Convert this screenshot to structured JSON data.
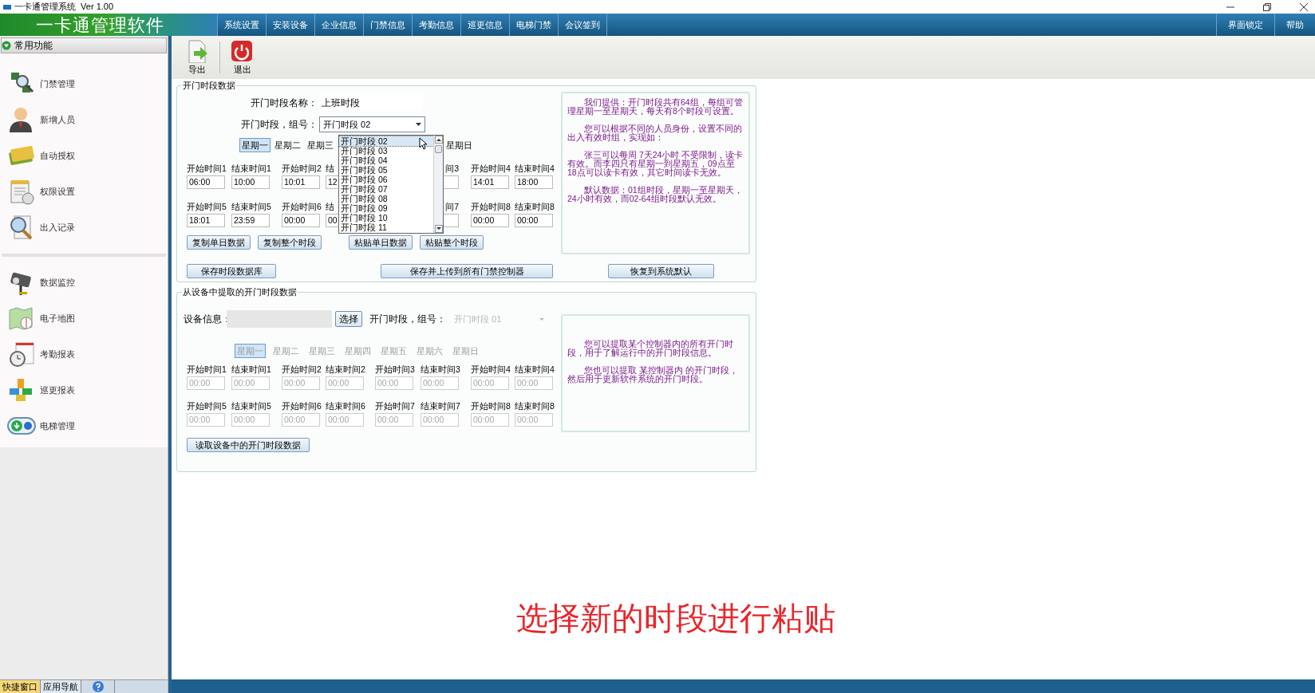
{
  "window": {
    "title": "一卡通管理系统  Ver 1.00"
  },
  "menu_bar": {
    "app_name": "一卡通管理软件",
    "items": [
      "系统设置",
      "安装设备",
      "企业信息",
      "门禁信息",
      "考勤信息",
      "巡更信息",
      "电梯门禁",
      "会议签到"
    ],
    "right_items": [
      "界面锁定",
      "帮助"
    ]
  },
  "sidebar": {
    "header": "常用功能",
    "groups": [
      [
        "门禁管理",
        "新增人员",
        "自动授权",
        "权限设置",
        "出入记录"
      ],
      [
        "数据监控",
        "电子地图",
        "考勤报表",
        "巡更报表",
        "电梯管理"
      ]
    ],
    "bottom_tabs": [
      {
        "label": "快捷窗口",
        "selected": true
      },
      {
        "label": "应用导航",
        "selected": false
      }
    ]
  },
  "toolbar": [
    "导出",
    "退出"
  ],
  "period_section": {
    "title": "开门时段数据",
    "name_label": "开门时段名称：",
    "name_value": "上班时段",
    "group_label": "开门时段，组号：",
    "group_value": "开门时段 02",
    "weekdays": [
      {
        "label": "星期一",
        "selected": true
      },
      {
        "label": "星期二",
        "selected": false
      },
      {
        "label": "星期三",
        "selected": false
      },
      {
        "label": "星期日",
        "selected": false
      }
    ],
    "rows": [
      [
        {
          "kind": "field",
          "label": "开始时间1",
          "value": "06:00"
        },
        {
          "kind": "field",
          "label": "结束时间1",
          "value": "10:00"
        },
        {
          "kind": "field",
          "label": "开始时间2",
          "value": "10:01"
        },
        {
          "kind": "field",
          "label": "结",
          "value": "12"
        },
        {
          "kind": "covered"
        },
        {
          "kind": "tail",
          "label": "间3"
        },
        {
          "kind": "field",
          "label": "开始时间4",
          "value": "14:01"
        },
        {
          "kind": "field",
          "label": "结束时间4",
          "value": "18:00"
        }
      ],
      [
        {
          "kind": "field",
          "label": "开始时间5",
          "value": "18:01"
        },
        {
          "kind": "field",
          "label": "结束时间5",
          "value": "23:59"
        },
        {
          "kind": "field",
          "label": "开始时间6",
          "value": "00:00"
        },
        {
          "kind": "field",
          "label": "结",
          "value": "00"
        },
        {
          "kind": "covered"
        },
        {
          "kind": "tail",
          "label": "间7"
        },
        {
          "kind": "field",
          "label": "开始时间8",
          "value": "00:00"
        },
        {
          "kind": "field",
          "label": "结束时间8",
          "value": "00:00"
        }
      ]
    ],
    "copy_buttons": [
      "复制单日数据",
      "复制整个时段"
    ],
    "paste_buttons": [
      "粘贴单日数据",
      "粘贴整个时段"
    ],
    "save_buttons": [
      "保存时段数据库",
      "保存并上传到所有门禁控制器",
      "恢复到系统默认"
    ],
    "info": [
      "我们提供：开门时段共有64组，每组可管理星期一至星期天，每天有8个时段可设置。",
      "您可以根据不同的人员身份，设置不同的出入有效时组，实现如：",
      "张三可以每周 7天24小时 不受限制，读卡有效。而李四只有星期一到星期五，09点至18点可以读卡有效，其它时间读卡无效。",
      "默认数据：01组时段，星期一至星期天，24小时有效，而02-64组时段默认无效。"
    ],
    "dropdown": [
      {
        "label": "开门时段 02",
        "selected": true
      },
      {
        "label": "开门时段 03",
        "selected": false
      },
      {
        "label": "开门时段 04",
        "selected": false
      },
      {
        "label": "开门时段 05",
        "selected": false
      },
      {
        "label": "开门时段 06",
        "selected": false
      },
      {
        "label": "开门时段 07",
        "selected": false
      },
      {
        "label": "开门时段 08",
        "selected": false
      },
      {
        "label": "开门时段 09",
        "selected": false
      },
      {
        "label": "开门时段 10",
        "selected": false
      },
      {
        "label": "开门时段 11",
        "selected": false
      }
    ]
  },
  "device_section": {
    "title": "从设备中提取的开门时段数据",
    "device_label": "设备信息：",
    "select_button": "选择",
    "group_label": "开门时段，组号：",
    "group_value": "开门时段 01",
    "weekdays": [
      {
        "label": "星期一",
        "selected": true
      },
      {
        "label": "星期二",
        "selected": false
      },
      {
        "label": "星期三",
        "selected": false
      },
      {
        "label": "星期四",
        "selected": false
      },
      {
        "label": "星期五",
        "selected": false
      },
      {
        "label": "星期六",
        "selected": false
      },
      {
        "label": "星期日",
        "selected": false
      }
    ],
    "rows": [
      [
        {
          "kind": "field",
          "label": "开始时间1",
          "value": "00:00"
        },
        {
          "kind": "field",
          "label": "结束时间1",
          "value": "00:00"
        },
        {
          "kind": "field",
          "label": "开始时间2",
          "value": "00:00"
        },
        {
          "kind": "field",
          "label": "结束时间2",
          "value": "00:00"
        },
        {
          "kind": "field",
          "label": "开始时间3",
          "value": "00:00"
        },
        {
          "kind": "field",
          "label": "结束时间3",
          "value": "00:00"
        },
        {
          "kind": "field",
          "label": "开始时间4",
          "value": "00:00"
        },
        {
          "kind": "field",
          "label": "结束时间4",
          "value": "00:00"
        }
      ],
      [
        {
          "kind": "field",
          "label": "开始时间5",
          "value": "00:00"
        },
        {
          "kind": "field",
          "label": "结束时间5",
          "value": "00:00"
        },
        {
          "kind": "field",
          "label": "开始时间6",
          "value": "00:00"
        },
        {
          "kind": "field",
          "label": "结束时间6",
          "value": "00:00"
        },
        {
          "kind": "field",
          "label": "开始时间7",
          "value": "00:00"
        },
        {
          "kind": "field",
          "label": "结束时间7",
          "value": "00:00"
        },
        {
          "kind": "field",
          "label": "开始时间8",
          "value": "00:00"
        },
        {
          "kind": "field",
          "label": "结束时间8",
          "value": "00:00"
        }
      ]
    ],
    "read_button": "读取设备中的开门时段数据",
    "info": [
      "您可以提取某个控制器内的所有开门时段，用于了解运行中的开门时段信息。",
      "您也可以提取 某控制器内 的开门时段，然后用于更新软件系统的开门时段。"
    ]
  },
  "caption": "选择新的时段进行粘贴"
}
